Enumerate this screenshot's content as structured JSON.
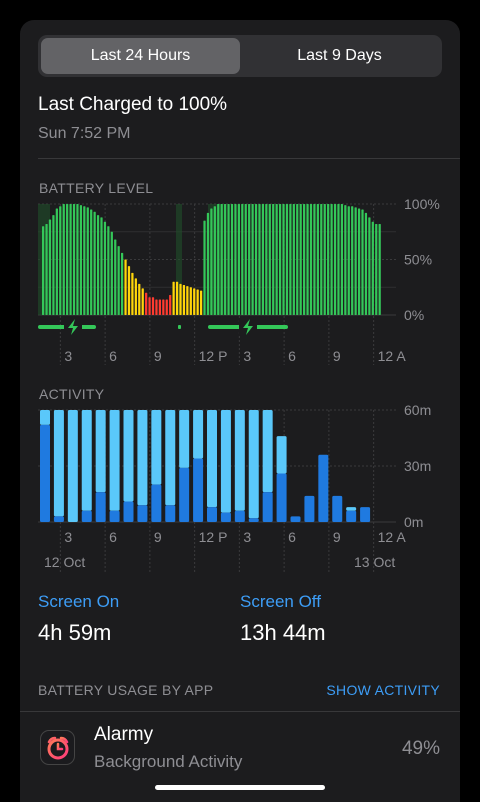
{
  "tabs": [
    {
      "label": "Last 24 Hours",
      "selected": true
    },
    {
      "label": "Last 9 Days",
      "selected": false
    }
  ],
  "last_charged": {
    "title": "Last Charged to 100%",
    "time": "Sun 7:52 PM"
  },
  "battery": {
    "section_label": "BATTERY LEVEL",
    "y_ticks": [
      "100%",
      "50%",
      "0%"
    ],
    "x_ticks": [
      "3",
      "6",
      "9",
      "12 P",
      "3",
      "6",
      "9",
      "12 A"
    ],
    "colors": {
      "normal": "#34c759",
      "low": "#ffd60a",
      "critical": "#ff3b30",
      "charging_bg": "#1f4f2a"
    },
    "charging_icon": "bolt-icon"
  },
  "activity": {
    "section_label": "ACTIVITY",
    "y_ticks": [
      "60m",
      "30m",
      "0m"
    ],
    "x_ticks": [
      "3",
      "6",
      "9",
      "12 P",
      "3",
      "6",
      "9",
      "12 A"
    ],
    "date_labels": [
      "12 Oct",
      "13 Oct"
    ],
    "colors": {
      "screen_on": "#1f7ae0",
      "screen_off": "#5ac8fa"
    }
  },
  "chart_data": [
    {
      "type": "bar",
      "title": "BATTERY LEVEL",
      "ylim": [
        0,
        100
      ],
      "categories": [
        "1",
        "2",
        "3",
        "4",
        "5",
        "6",
        "7",
        "8",
        "9",
        "10",
        "11",
        "12",
        "13",
        "14",
        "15",
        "16",
        "17",
        "18",
        "19",
        "20",
        "21",
        "22",
        "23",
        "24",
        "25",
        "26",
        "27",
        "28",
        "29",
        "30",
        "31",
        "32",
        "33",
        "34",
        "35",
        "36",
        "37",
        "38",
        "39",
        "40",
        "41",
        "42",
        "43",
        "44",
        "45",
        "46",
        "47",
        "48",
        "49",
        "50",
        "51",
        "52",
        "53",
        "54",
        "55",
        "56",
        "57",
        "58",
        "59",
        "60",
        "61",
        "62",
        "63",
        "64",
        "65",
        "66",
        "67",
        "68",
        "69",
        "70",
        "71",
        "72",
        "73",
        "74",
        "75",
        "76",
        "77",
        "78",
        "79",
        "80",
        "81",
        "82",
        "83",
        "84",
        "85",
        "86",
        "87",
        "88",
        "89",
        "90",
        "91",
        "92",
        "93",
        "94",
        "95",
        "96",
        "97",
        "98",
        "99"
      ],
      "values": [
        80,
        82,
        86,
        90,
        96,
        98,
        100,
        100,
        100,
        100,
        100,
        99,
        98,
        97,
        95,
        93,
        90,
        88,
        84,
        80,
        75,
        68,
        62,
        56,
        50,
        44,
        38,
        33,
        28,
        24,
        20,
        16,
        16,
        14,
        14,
        14,
        14,
        18,
        30,
        30,
        28,
        27,
        26,
        25,
        24,
        23,
        22,
        85,
        92,
        96,
        98,
        100,
        100,
        100,
        100,
        100,
        100,
        100,
        100,
        100,
        100,
        100,
        100,
        100,
        100,
        100,
        100,
        100,
        100,
        100,
        100,
        100,
        100,
        100,
        100,
        100,
        100,
        100,
        100,
        100,
        100,
        100,
        100,
        100,
        100,
        100,
        100,
        100,
        99,
        98,
        98,
        97,
        96,
        95,
        92,
        88,
        84,
        82,
        82
      ]
    },
    {
      "type": "bar",
      "title": "ACTIVITY",
      "ylim": [
        0,
        60
      ],
      "categories": [
        "1",
        "2",
        "3",
        "4",
        "5",
        "6",
        "7",
        "8",
        "9",
        "10",
        "11",
        "12",
        "13",
        "14",
        "15",
        "16",
        "17",
        "18",
        "19",
        "20",
        "21",
        "22",
        "23",
        "24"
      ],
      "series": [
        {
          "name": "Screen On",
          "values": [
            52,
            3,
            0,
            6,
            16,
            6,
            11,
            9,
            20,
            9,
            29,
            34,
            8,
            5,
            6,
            2,
            16,
            26,
            3,
            14,
            36,
            14,
            6,
            8
          ]
        },
        {
          "name": "Screen Off",
          "values": [
            8,
            57,
            60,
            54,
            44,
            54,
            49,
            51,
            40,
            51,
            31,
            26,
            52,
            55,
            54,
            58,
            44,
            20,
            0,
            0,
            0,
            0,
            2,
            0
          ]
        }
      ]
    }
  ],
  "screen_on": {
    "label": "Screen On",
    "value": "4h 59m"
  },
  "screen_off": {
    "label": "Screen Off",
    "value": "13h 44m"
  },
  "usage": {
    "heading": "BATTERY USAGE BY APP",
    "link": "SHOW ACTIVITY"
  },
  "apps": [
    {
      "name": "Alarmy",
      "subtitle": "Background Activity",
      "percent": "49%",
      "icon": "alarm-clock-icon"
    }
  ]
}
